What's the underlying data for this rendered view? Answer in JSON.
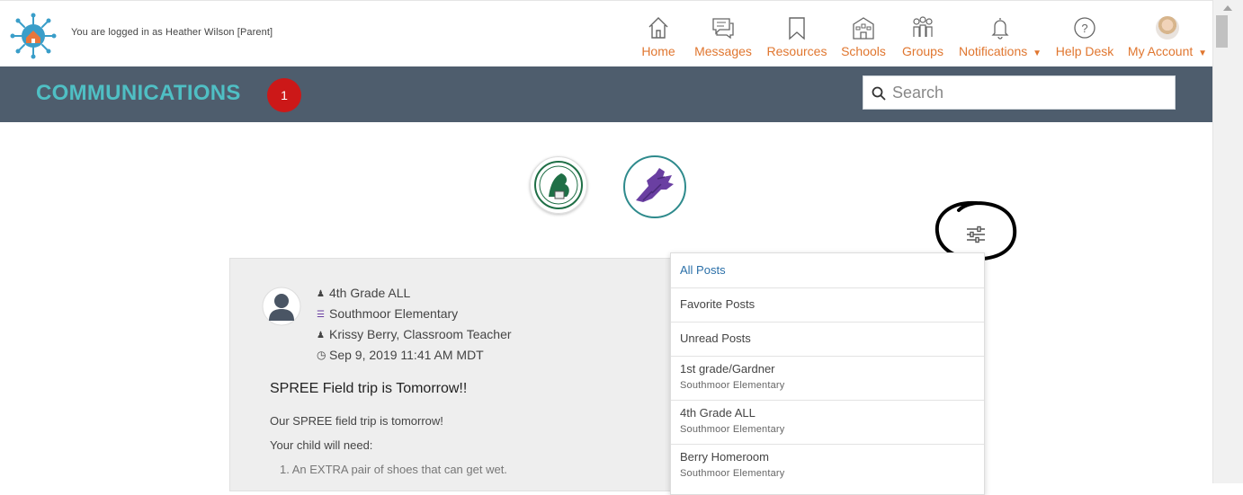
{
  "header": {
    "login_text": "You are logged in as Heather Wilson [Parent]",
    "nav": [
      {
        "label": "Home",
        "icon": "home-icon"
      },
      {
        "label": "Messages",
        "icon": "messages-icon"
      },
      {
        "label": "Resources",
        "icon": "bookmark-icon"
      },
      {
        "label": "Schools",
        "icon": "school-icon"
      },
      {
        "label": "Groups",
        "icon": "groups-icon"
      },
      {
        "label": "Notifications",
        "icon": "bell-icon",
        "caret": "▼"
      },
      {
        "label": "Help Desk",
        "icon": "question-icon"
      },
      {
        "label": "My Account",
        "icon": "avatar",
        "caret": "▼"
      }
    ]
  },
  "banner": {
    "title": "COMMUNICATIONS",
    "badge_count": "1",
    "search_placeholder": "Search"
  },
  "post": {
    "group": "4th Grade ALL",
    "school": "Southmoor Elementary",
    "author": "Krissy Berry, Classroom Teacher",
    "timestamp": "Sep 9, 2019 11:41 AM MDT",
    "title": "SPREE Field trip is Tomorrow!!",
    "body": [
      "Our SPREE field trip is tomorrow!",
      "Your child will need:",
      "1. An EXTRA pair of shoes that can get wet."
    ]
  },
  "filter_menu": {
    "items": [
      {
        "title": "All Posts",
        "subtitle": ""
      },
      {
        "title": "Favorite Posts",
        "subtitle": ""
      },
      {
        "title": "Unread Posts",
        "subtitle": ""
      },
      {
        "title": "1st grade/Gardner",
        "subtitle": "Southmoor Elementary"
      },
      {
        "title": "4th Grade ALL",
        "subtitle": "Southmoor Elementary"
      },
      {
        "title": "Berry Homeroom",
        "subtitle": "Southmoor Elementary"
      }
    ]
  },
  "colors": {
    "accent_orange": "#e0762f",
    "banner_bg": "#4e5d6d",
    "title_teal": "#4fbfc4",
    "badge_red": "#cc1818",
    "active_blue": "#2a6fa8"
  }
}
